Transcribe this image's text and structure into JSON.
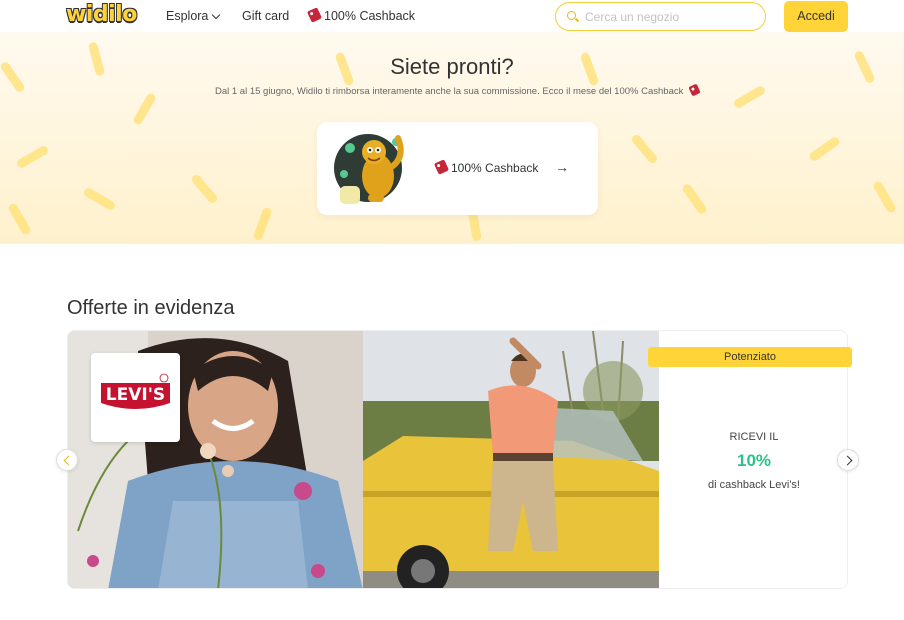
{
  "header": {
    "logo_text": "widilo",
    "nav": {
      "explore_label": "Esplora",
      "gift_label": "Gift card",
      "cashback_label": "100% Cashback"
    },
    "search": {
      "placeholder": "Cerca un negozio",
      "value": ""
    },
    "login_label": "Accedi"
  },
  "hero": {
    "title": "Siete pronti?",
    "subtitle": "Dal 1 al 15 giugno, Widilo ti rimborsa interamente anche la sua commissione. Ecco il mese del 100% Cashback",
    "card_label": "100% Cashback",
    "card_arrow": "→"
  },
  "featured": {
    "title": "Offerte in evidenza",
    "brand": "Levi's",
    "logo_text": "LEVI'S",
    "badge": "Potenziato",
    "offer_line1": "RICEVI IL",
    "offer_pct": "10%",
    "offer_line2": "di cashback Levi's!"
  },
  "colors": {
    "brand_yellow": "#ffd439",
    "cashback_green": "#2cc18a",
    "levis_red": "#c41230"
  },
  "icons": {
    "search": "search-icon",
    "tag": "tag-icon",
    "chevron": "chevron-down-icon",
    "arrow_right": "arrow-right-icon",
    "prev": "chevron-left-icon",
    "next": "chevron-right-icon"
  }
}
